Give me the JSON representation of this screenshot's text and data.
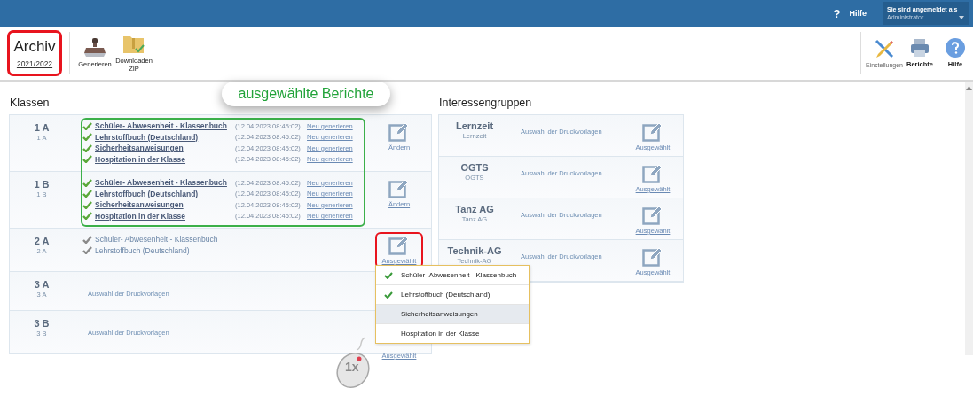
{
  "topbar": {
    "help_icon": "?",
    "help": "Hilfe",
    "user_label": "Sie sind angemeldet als",
    "user": "Administrator"
  },
  "toolbar": {
    "archive": {
      "title": "Archiv",
      "year": "2021/2022",
      "highlighted": true
    },
    "left_buttons": [
      {
        "label": "Generieren",
        "kind": "stamp"
      },
      {
        "label": "Downloaden ZIP",
        "kind": "zip"
      }
    ],
    "right_buttons": [
      {
        "label": "Einstellungen",
        "kind": "tools"
      },
      {
        "label": "Berichte",
        "kind": "printer"
      },
      {
        "label": "Hilfe",
        "kind": "help"
      }
    ]
  },
  "callout": "ausgewählte Berichte",
  "classes": {
    "heading": "Klassen",
    "rows": [
      {
        "name": "1 A",
        "sub": "1 A",
        "reports": [
          {
            "title": "Schüler- Abwesenheit - Klassenbuch",
            "date": "(12.04.2023 08:45:02)",
            "action": "Neu generieren",
            "kind": "generated"
          },
          {
            "title": "Lehrstoffbuch (Deutschland)",
            "date": "(12.04.2023 08:45:02)",
            "action": "Neu generieren",
            "kind": "generated"
          },
          {
            "title": "Sicherheitsanweisungen",
            "date": "(12.04.2023 08:45:02)",
            "action": "Neu generieren",
            "kind": "generated"
          },
          {
            "title": "Hospitation in der Klasse",
            "date": "(12.04.2023 08:45:02)",
            "action": "Neu generieren",
            "kind": "generated"
          }
        ],
        "edit": {
          "label": "Ändern",
          "icon": true,
          "highlighted": false
        }
      },
      {
        "name": "1 B",
        "sub": "1 B",
        "reports": [
          {
            "title": "Schüler- Abwesenheit - Klassenbuch",
            "date": "(12.04.2023 08:45:02)",
            "action": "Neu generieren",
            "kind": "generated"
          },
          {
            "title": "Lehrstoffbuch (Deutschland)",
            "date": "(12.04.2023 08:45:02)",
            "action": "Neu generieren",
            "kind": "generated"
          },
          {
            "title": "Sicherheitsanweisungen",
            "date": "(12.04.2023 08:45:02)",
            "action": "Neu generieren",
            "kind": "generated"
          },
          {
            "title": "Hospitation in der Klasse",
            "date": "(12.04.2023 08:45:02)",
            "action": "Neu generieren",
            "kind": "generated"
          }
        ],
        "edit": {
          "label": "Ändern",
          "icon": true,
          "highlighted": false
        }
      },
      {
        "name": "2 A",
        "sub": "2 A",
        "reports": [
          {
            "title": "Schüler- Abwesenheit - Klassenbuch",
            "kind": "chosen"
          },
          {
            "title": "Lehrstoffbuch (Deutschland)",
            "kind": "chosen"
          }
        ],
        "edit": {
          "label": "Ausgewählt",
          "icon": true,
          "highlighted": true
        }
      },
      {
        "name": "3 A",
        "sub": "3 A",
        "hint": "Auswahl der Druckvorlagen"
      },
      {
        "name": "3 B",
        "sub": "3 B",
        "hint": "Auswahl der Druckvorlagen",
        "edit": {
          "label": "Ausgewählt",
          "icon": false
        }
      }
    ]
  },
  "groups": {
    "heading": "Interessengruppen",
    "rows": [
      {
        "name": "Lernzeit",
        "sub": "Lernzeit",
        "hint": "Auswahl der Druckvorlagen",
        "edit": "Ausgewählt"
      },
      {
        "name": "OGTS",
        "sub": "OGTS",
        "hint": "Auswahl der Druckvorlagen",
        "edit": "Ausgewählt"
      },
      {
        "name": "Tanz AG",
        "sub": "Tanz AG",
        "hint": "Auswahl der Druckvorlagen",
        "edit": "Ausgewählt"
      },
      {
        "name": "Technik-AG",
        "sub": "Technik-AG",
        "hint": "Auswahl der Druckvorlagen",
        "edit": "Ausgewählt"
      }
    ]
  },
  "menu": [
    {
      "label": "Schüler- Abwesenheit - Klassenbuch",
      "checked": true,
      "selected": false
    },
    {
      "label": "Lehrstoffbuch (Deutschland)",
      "checked": true,
      "selected": false
    },
    {
      "label": "Sicherheitsanweisungen",
      "checked": false,
      "selected": true
    },
    {
      "label": "Hospitation in der Klasse",
      "checked": false,
      "selected": false
    }
  ],
  "click_badge": "1x"
}
